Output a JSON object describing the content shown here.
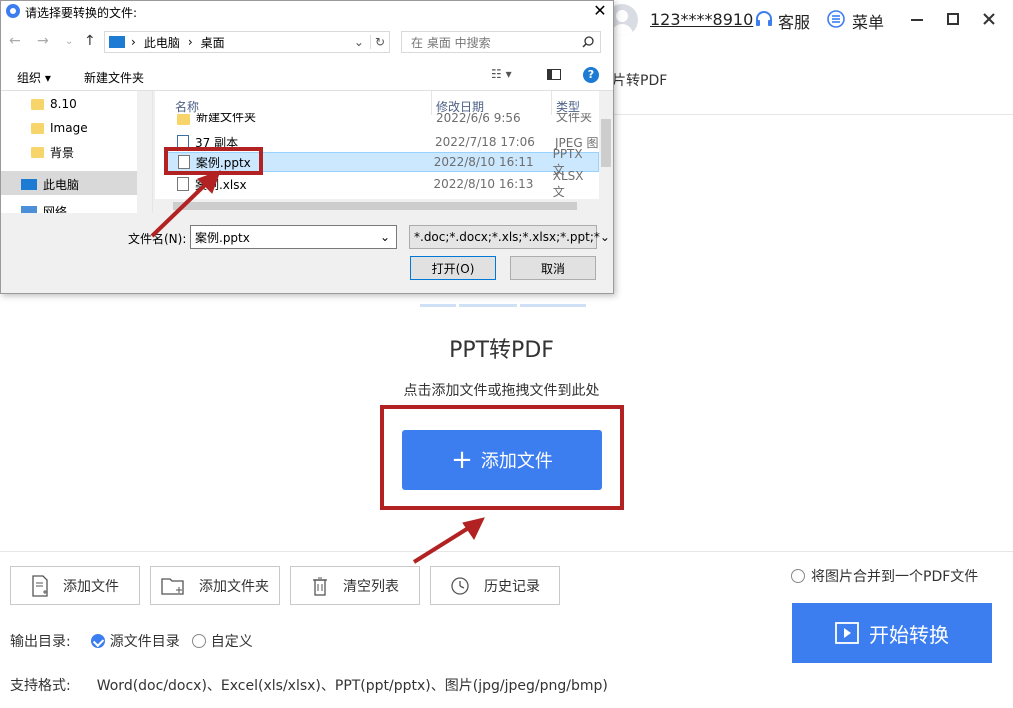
{
  "header": {
    "user_label": "123****8910",
    "service_label": "客服",
    "menu_label": "菜单",
    "tab_label": "片转PDF"
  },
  "dropzone": {
    "title": "PPT转PDF",
    "subtitle": "点击添加文件或拖拽文件到此处",
    "add_label": "添加文件"
  },
  "toolbar": {
    "add_file": "添加文件",
    "add_folder": "添加文件夹",
    "clear_list": "清空列表",
    "history": "历史记录"
  },
  "options": {
    "merge_label": "将图片合并到一个PDF文件",
    "output_label": "输出目录:",
    "source_dir": "源文件目录",
    "custom": "自定义",
    "start_label": "开始转换",
    "formats_label": "支持格式:",
    "formats_value": "Word(doc/docx)、Excel(xls/xlsx)、PPT(ppt/pptx)、图片(jpg/jpeg/png/bmp)"
  },
  "dialog": {
    "title": "请选择要转换的文件:",
    "breadcrumb": [
      "此电脑",
      "桌面"
    ],
    "search_placeholder": "在 桌面 中搜索",
    "organize": "组织",
    "new_folder": "新建文件夹",
    "tree": [
      "8.10",
      "Image",
      "背景",
      "此电脑",
      "网络"
    ],
    "columns": {
      "name": "名称",
      "modified": "修改日期",
      "type": "类型"
    },
    "files": [
      {
        "name": "新建文件夹",
        "date": "2022/6/6 9:56",
        "type": "文件夹"
      },
      {
        "name": "37 副本",
        "date": "2022/7/18 17:06",
        "type": "JPEG 图"
      },
      {
        "name": "案例.pptx",
        "date": "2022/8/10 16:11",
        "type": "PPTX 文"
      },
      {
        "name": "案例.xlsx",
        "date": "2022/8/10 16:13",
        "type": "XLSX 文"
      }
    ],
    "filename_label": "文件名(N):",
    "filename_value": "案例.pptx",
    "filetype_value": "*.doc;*.docx;*.xls;*.xlsx;*.ppt;*",
    "open": "打开(O)",
    "cancel": "取消"
  },
  "colors": {
    "accent": "#3c7ef0",
    "highlight": "#b22222"
  }
}
